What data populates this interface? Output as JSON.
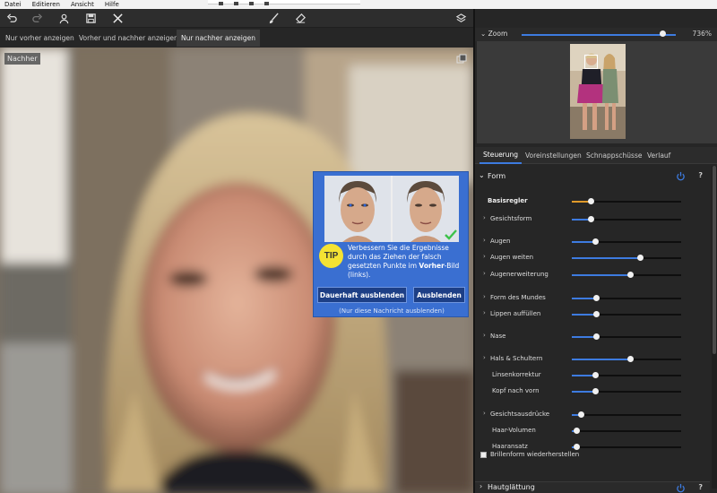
{
  "menubar": {
    "items": [
      "Datei",
      "Editieren",
      "Ansicht",
      "Hilfe"
    ]
  },
  "toolbar": {
    "icons": [
      "undo-icon",
      "redo-icon",
      "face-select-icon",
      "save-icon",
      "close-icon",
      "brush-icon",
      "eraser-icon",
      "layers-icon"
    ]
  },
  "view_tabs": [
    {
      "label": "Nur vorher anzeigen",
      "active": false
    },
    {
      "label": "Vorher und nachher anzeigen",
      "active": false
    },
    {
      "label": "Nur nachher anzeigen",
      "active": true
    }
  ],
  "canvas": {
    "label": "Nachher"
  },
  "tip": {
    "badge": "TIP",
    "text_1": "Verbessern Sie die Ergebnisse durch das Ziehen der falsch gesetzten Punkte im ",
    "text_bold": "Vorher",
    "text_2": "-Bild (links).",
    "btn_hide_permanent": "Dauerhaft ausblenden",
    "btn_hide": "Ausblenden",
    "footer": "(Nur diese Nachricht ausblenden)"
  },
  "zoom": {
    "label": "Zoom",
    "value": "736%",
    "level": 0.89
  },
  "panel_tabs": [
    {
      "label": "Steuerung",
      "active": true
    },
    {
      "label": "Voreinstellungen",
      "active": false
    },
    {
      "label": "Schnappschüsse",
      "active": false
    },
    {
      "label": "Verlauf",
      "active": false
    }
  ],
  "section": {
    "title": "Form",
    "help": "?"
  },
  "sliders": [
    {
      "label": "Basisregler",
      "bold": true,
      "expandable": false,
      "indent": false,
      "value": 0.17,
      "fill_color": "#e09a2a"
    },
    {
      "label": "Gesichtsform",
      "bold": false,
      "expandable": true,
      "indent": false,
      "value": 0.17
    },
    {
      "label": "Augen",
      "bold": false,
      "expandable": true,
      "indent": false,
      "value": 0.21
    },
    {
      "label": "Augen weiten",
      "bold": false,
      "expandable": true,
      "indent": false,
      "value": 0.62
    },
    {
      "label": "Augenerweiterung",
      "bold": false,
      "expandable": true,
      "indent": false,
      "value": 0.53
    },
    {
      "label": "Form des Mundes",
      "bold": false,
      "expandable": true,
      "indent": false,
      "value": 0.22
    },
    {
      "label": "Lippen auffüllen",
      "bold": false,
      "expandable": true,
      "indent": false,
      "value": 0.22
    },
    {
      "label": "Nase",
      "bold": false,
      "expandable": true,
      "indent": false,
      "value": 0.22
    },
    {
      "label": "Hals & Schultern",
      "bold": false,
      "expandable": true,
      "indent": false,
      "value": 0.53
    },
    {
      "label": "Linsenkorrektur",
      "bold": false,
      "expandable": false,
      "indent": true,
      "value": 0.21
    },
    {
      "label": "Kopf nach vorn",
      "bold": false,
      "expandable": false,
      "indent": true,
      "value": 0.21
    },
    {
      "label": "Gesichtsausdrücke",
      "bold": false,
      "expandable": true,
      "indent": false,
      "value": 0.08
    },
    {
      "label": "Haar-Volumen",
      "bold": false,
      "expandable": false,
      "indent": true,
      "value": 0.04
    },
    {
      "label": "Haaransatz",
      "bold": false,
      "expandable": false,
      "indent": true,
      "value": 0.04
    }
  ],
  "checkbox": {
    "label": "Brillenform wiederherstellen",
    "checked": false
  },
  "bottom_section": {
    "title": "Hautglättung",
    "help": "?"
  },
  "colors": {
    "accent": "#3d7be0",
    "tip_bg": "#3a6fd1",
    "tip_badge": "#f4e233"
  }
}
